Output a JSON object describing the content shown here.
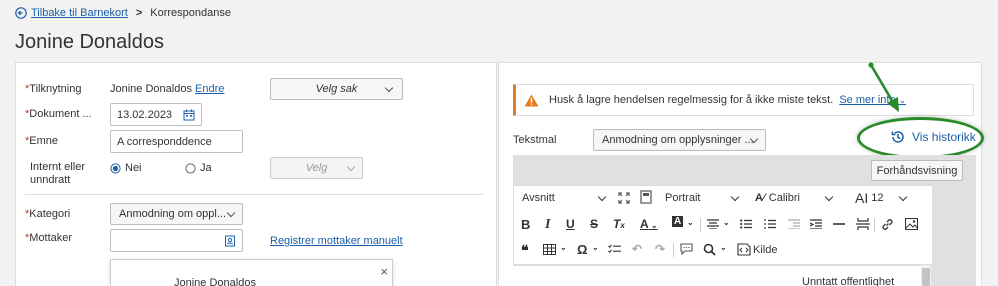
{
  "breadcrumb": {
    "back_label": "Tilbake til Barnekort",
    "separator": ">",
    "current": "Korrespondanse"
  },
  "page_title": "Jonine Donaldos",
  "form": {
    "tilknytning_label": "Tilknytning",
    "tilknytning_value": "Jonine Donaldos",
    "tilknytning_link": "Endre",
    "velg_sak": "Velg sak",
    "dokument_label": "Dokument ...",
    "dokument_value": "13.02.2023",
    "emne_label": "Emne",
    "emne_value": "A corresponddence",
    "internt_label_1": "Internt eller",
    "internt_label_2": "unndratt",
    "radio_nei": "Nei",
    "radio_ja": "Ja",
    "velg": "Velg",
    "kategori_label": "Kategori",
    "kategori_value": "Anmodning om oppl...",
    "mottaker_label": "Mottaker",
    "mottaker_link": "Registrer mottaker manuelt",
    "popup_name": "Jonine Donaldos",
    "required_mark": "*"
  },
  "editor": {
    "warning_text": "Husk å lagre hendelsen regelmessig for å ikke miste tekst.",
    "warning_link": "Se mer info",
    "tekstmal_label": "Tekstmal",
    "tekstmal_value": "Anmodning om opplysninger ...",
    "vis_historikk": "Vis historikk",
    "forhandsvisning": "Forhåndsvisning",
    "toolbar": {
      "paragraph": "Avsnitt",
      "orientation": "Portrait",
      "font": "Calibri",
      "font_size": "12",
      "source": "Kilde"
    },
    "doc_text": "Unntatt offentlighet"
  },
  "colors": {
    "link": "#1a5fa8",
    "required": "#c0392b",
    "warning": "#e67e22",
    "highlight": "#2a8a2a"
  }
}
